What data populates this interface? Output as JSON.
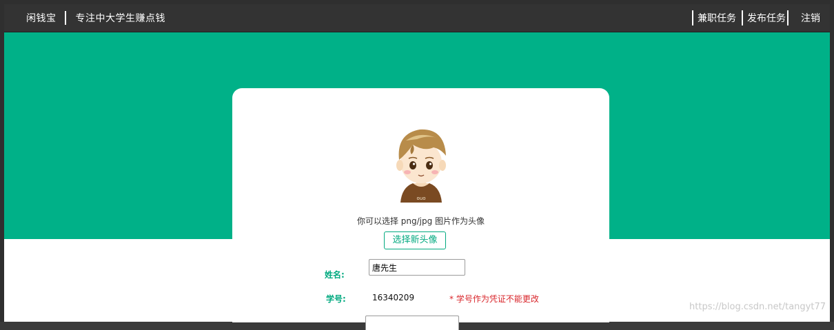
{
  "header": {
    "brand": "闲钱宝",
    "slogan": "专注中大学生赚点钱",
    "nav": {
      "jobs": "兼职任务",
      "publish": "发布任务",
      "logout": "注销"
    }
  },
  "profile": {
    "avatar_hint": "你可以选择 png/jpg 图片作为头像",
    "choose_avatar_label": "选择新头像",
    "name_label": "姓名:",
    "name_value": "唐先生",
    "student_id_label": "学号:",
    "student_id_value": "16340209",
    "student_id_note": "* 学号作为凭证不能更改"
  },
  "watermark": "https://blog.csdn.net/tangyt77",
  "colors": {
    "topbar": "#333333",
    "brand_green": "#00b188",
    "accent_green": "#00a97f",
    "warning_red": "#d9262b"
  }
}
